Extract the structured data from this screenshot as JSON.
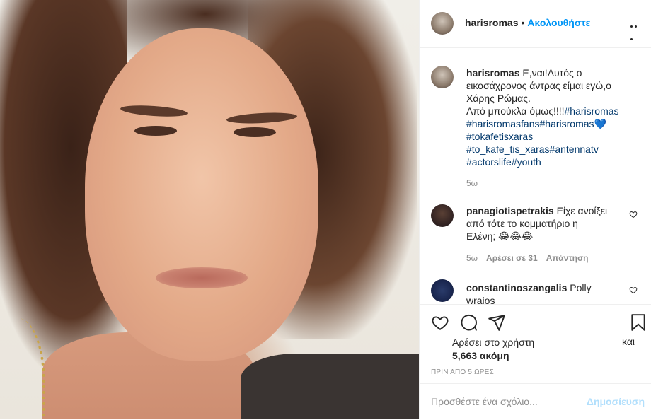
{
  "post": {
    "username": "harisromas",
    "follow_label": "Ακολουθήστε",
    "separator": "•",
    "more_icon": "more-horizontal-icon"
  },
  "caption": {
    "username": "harisromas",
    "text_line1": "Ε,ναι!Αυτός ο",
    "text_line2": "εικοσάχρονος άντρας είμαι εγώ,ο",
    "text_line3": "Χάρης Ρώμας.",
    "text_line4": "Από μπούκλα όμως!!!!",
    "hashtags": [
      "#harisromas",
      "#harisromasfans",
      "#harisromas",
      "#tokafetisxaras",
      "#to_kafe_tis_xaras",
      "#antennatv",
      "#actorslife",
      "#youth"
    ],
    "emoji": "💙",
    "time": "5ω"
  },
  "comments": [
    {
      "username": "panagiotispetrakis",
      "text_line1": "Είχε ανοίξει",
      "text_line2": "από τότε το κομματήριο η",
      "text_line3": "Ελένη; 😂😂😂",
      "time": "5ω",
      "likes": "Αρέσει σε 31",
      "reply": "Απάντηση"
    },
    {
      "username": "constantinoszangalis",
      "text": "Polly wraios"
    }
  ],
  "actions": {
    "like_icon": "heart-icon",
    "comment_icon": "comment-icon",
    "share_icon": "share-icon",
    "save_icon": "bookmark-icon",
    "liked_by_prefix": "Αρέσει στο χρήστη",
    "liked_by_tail": "και",
    "likes_more": "5,663 ακόμη",
    "time_ago": "ΠΡΙΝ ΑΠΟ 5 ΩΡΕΣ"
  },
  "add_comment": {
    "placeholder": "Προσθέστε ένα σχόλιο...",
    "post_label": "Δημοσίευση"
  }
}
